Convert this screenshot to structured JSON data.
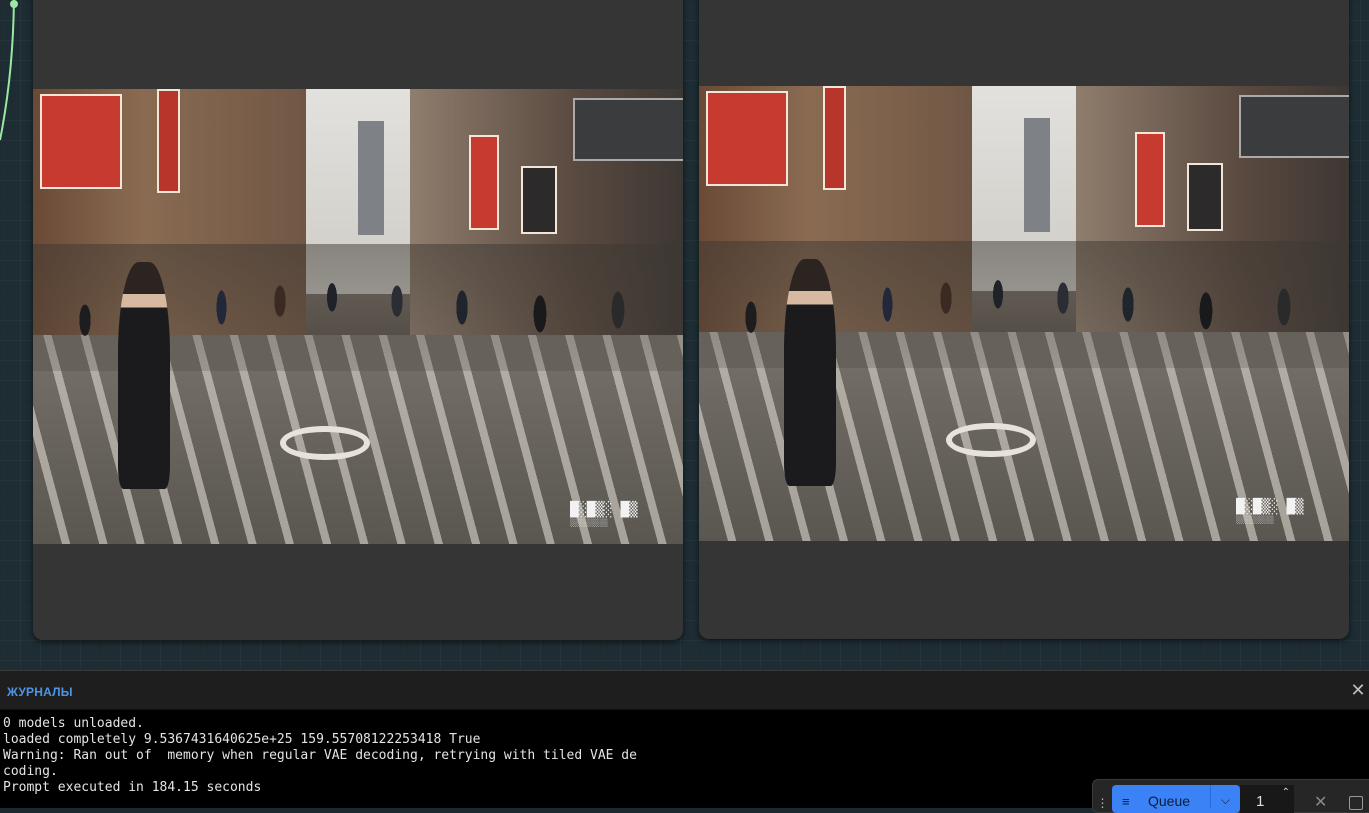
{
  "logs": {
    "title": "ЖУРНАЛЫ",
    "lines": [
      "0 models unloaded.",
      "loaded completely 9.5367431640625e+25 159.55708122253418 True",
      "Warning: Ran out of  memory when regular VAE decoding, retrying with tiled VAE de",
      "coding.",
      "Prompt executed in 184.15 seconds"
    ]
  },
  "queue": {
    "label": "Queue",
    "batch_count": "1"
  },
  "icons": {
    "close": "close-icon",
    "queue": "queue-list-icon",
    "chevron": "chevron-down-icon",
    "stepper": "chevron-up-icon",
    "cancel": "x-icon",
    "history": "square-icon"
  },
  "colors": {
    "accent": "#3b82f6",
    "logs_title": "#4f95e6",
    "node_bg": "#353535",
    "link_wire": "#9be8a0"
  }
}
